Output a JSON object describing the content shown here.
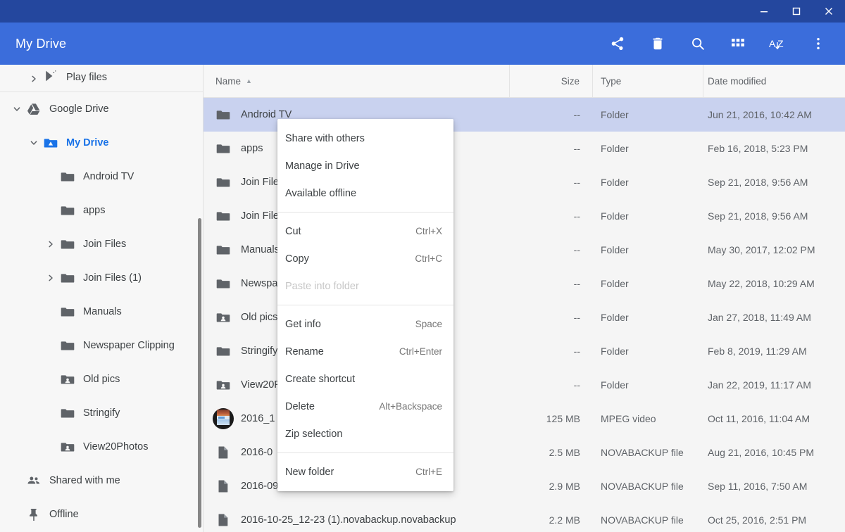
{
  "window": {
    "title_bar_color": "#24479e",
    "toolbar_color": "#3b6ddb",
    "minimize_label": "Minimize",
    "maximize_label": "Maximize",
    "close_label": "Close"
  },
  "toolbar": {
    "title": "My Drive",
    "actions": [
      {
        "name": "share-icon",
        "label": "Share"
      },
      {
        "name": "delete-icon",
        "label": "Delete"
      },
      {
        "name": "search-icon",
        "label": "Search"
      },
      {
        "name": "grid-view-icon",
        "label": "Switch to grid view"
      },
      {
        "name": "sort-az-icon",
        "label": "Sort A-Z"
      },
      {
        "name": "more-vert-icon",
        "label": "More options"
      }
    ]
  },
  "sidebar": {
    "items": [
      {
        "label": "Play files",
        "icon": "play-files-icon",
        "indent": 1,
        "twisty": "collapsed",
        "partial": true
      },
      {
        "label": "Google Drive",
        "icon": "google-drive-icon",
        "indent": 0,
        "twisty": "expanded"
      },
      {
        "label": "My Drive",
        "icon": "my-drive-icon",
        "indent": 1,
        "twisty": "expanded",
        "selected": true
      },
      {
        "label": "Android TV",
        "icon": "folder-icon",
        "indent": 2,
        "twisty": "none"
      },
      {
        "label": "apps",
        "icon": "folder-icon",
        "indent": 2,
        "twisty": "none"
      },
      {
        "label": "Join Files",
        "icon": "folder-icon",
        "indent": 2,
        "twisty": "collapsed"
      },
      {
        "label": "Join Files (1)",
        "icon": "folder-icon",
        "indent": 2,
        "twisty": "collapsed"
      },
      {
        "label": "Manuals",
        "icon": "folder-icon",
        "indent": 2,
        "twisty": "none"
      },
      {
        "label": "Newspaper Clipping",
        "icon": "folder-icon",
        "indent": 2,
        "twisty": "none"
      },
      {
        "label": "Old pics",
        "icon": "shared-folder-icon",
        "indent": 2,
        "twisty": "none"
      },
      {
        "label": "Stringify",
        "icon": "folder-icon",
        "indent": 2,
        "twisty": "none"
      },
      {
        "label": "View20Photos",
        "icon": "shared-folder-icon",
        "indent": 2,
        "twisty": "none"
      },
      {
        "label": "Shared with me",
        "icon": "people-icon",
        "indent": 0,
        "twisty": "none"
      },
      {
        "label": "Offline",
        "icon": "pin-icon",
        "indent": 0,
        "twisty": "none"
      }
    ]
  },
  "filelist": {
    "columns": {
      "name": "Name",
      "size": "Size",
      "type": "Type",
      "date": "Date modified"
    },
    "sort_column": "Name",
    "sort_direction": "ascending",
    "rows": [
      {
        "name": "Android TV",
        "icon": "folder-icon",
        "size": "--",
        "type": "Folder",
        "date": "Jun 21, 2016, 10:42 AM",
        "selected": true
      },
      {
        "name": "apps",
        "icon": "folder-icon",
        "size": "--",
        "type": "Folder",
        "date": "Feb 16, 2018, 5:23 PM"
      },
      {
        "name": "Join Files",
        "icon": "folder-icon",
        "size": "--",
        "type": "Folder",
        "date": "Sep 21, 2018, 9:56 AM"
      },
      {
        "name": "Join Files (1)",
        "icon": "folder-icon",
        "size": "--",
        "type": "Folder",
        "date": "Sep 21, 2018, 9:56 AM"
      },
      {
        "name": "Manuals",
        "icon": "folder-icon",
        "size": "--",
        "type": "Folder",
        "date": "May 30, 2017, 12:02 PM"
      },
      {
        "name": "Newspaper Clipping",
        "icon": "folder-icon",
        "size": "--",
        "type": "Folder",
        "date": "May 22, 2018, 10:29 AM"
      },
      {
        "name": "Old pics",
        "icon": "shared-folder-icon",
        "size": "--",
        "type": "Folder",
        "date": "Jan 27, 2018, 11:49 AM"
      },
      {
        "name": "Stringify",
        "icon": "folder-icon",
        "size": "--",
        "type": "Folder",
        "date": "Feb 8, 2019, 11:29 AM"
      },
      {
        "name": "View20Photos",
        "icon": "shared-folder-icon",
        "size": "--",
        "type": "Folder",
        "date": "Jan 22, 2019, 11:17 AM"
      },
      {
        "name": "2016_1",
        "icon": "video-thumbnail",
        "size": "125 MB",
        "type": "MPEG video",
        "date": "Oct 11, 2016, 11:04 AM"
      },
      {
        "name": "2016-0",
        "icon": "file-icon",
        "size": "2.5 MB",
        "type": "NOVABACKUP file",
        "date": "Aug 21, 2016, 10:45 PM"
      },
      {
        "name": "2016-09-11_07-49.novabackup.novabackup",
        "icon": "file-icon",
        "size": "2.9 MB",
        "type": "NOVABACKUP file",
        "date": "Sep 11, 2016, 7:50 AM"
      },
      {
        "name": "2016-10-25_12-23 (1).novabackup.novabackup",
        "icon": "file-icon",
        "size": "2.2 MB",
        "type": "NOVABACKUP file",
        "date": "Oct 25, 2016, 2:51 PM"
      }
    ]
  },
  "context_menu": {
    "groups": [
      [
        {
          "label": "Share with others",
          "accel": ""
        },
        {
          "label": "Manage in Drive",
          "accel": ""
        },
        {
          "label": "Available offline",
          "accel": ""
        }
      ],
      [
        {
          "label": "Cut",
          "accel": "Ctrl+X"
        },
        {
          "label": "Copy",
          "accel": "Ctrl+C"
        },
        {
          "label": "Paste into folder",
          "accel": "",
          "disabled": true
        }
      ],
      [
        {
          "label": "Get info",
          "accel": "Space"
        },
        {
          "label": "Rename",
          "accel": "Ctrl+Enter"
        },
        {
          "label": "Create shortcut",
          "accel": ""
        },
        {
          "label": "Delete",
          "accel": "Alt+Backspace"
        },
        {
          "label": "Zip selection",
          "accel": ""
        }
      ],
      [
        {
          "label": "New folder",
          "accel": "Ctrl+E"
        }
      ]
    ]
  },
  "colors": {
    "accent_blue": "#1a73e8",
    "selection": "#c9d2ef",
    "toolbar": "#3b6ddb",
    "titlebar": "#24479e"
  }
}
